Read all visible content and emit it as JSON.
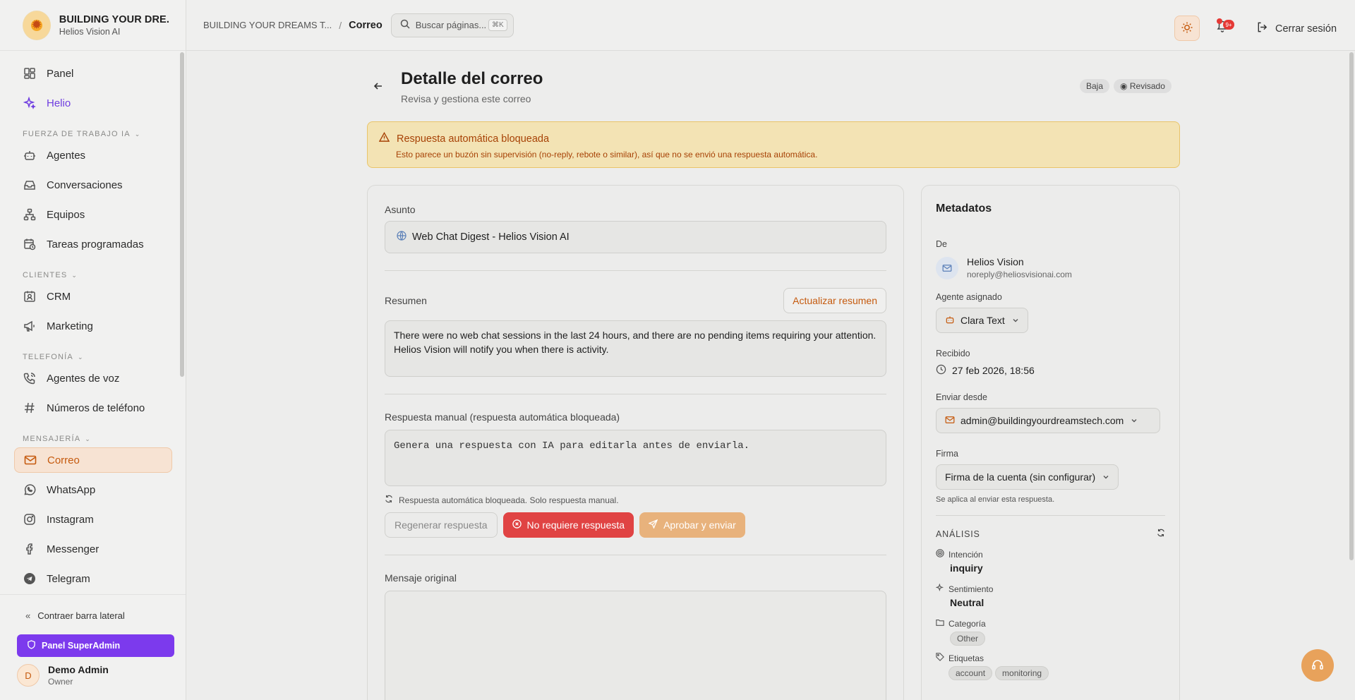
{
  "brand": {
    "name": "BUILDING YOUR DRE...",
    "sub": "Helios Vision AI"
  },
  "nav": {
    "panel": "Panel",
    "helio": "Helio",
    "section_ai": "FUERZA DE TRABAJO IA",
    "agents": "Agentes",
    "conversations": "Conversaciones",
    "teams": "Equipos",
    "scheduled": "Tareas programadas",
    "section_clients": "CLIENTES",
    "crm": "CRM",
    "marketing": "Marketing",
    "section_phone": "TELEFONÍA",
    "voice_agents": "Agentes de voz",
    "phone_numbers": "Números de teléfono",
    "section_messaging": "MENSAJERÍA",
    "email": "Correo",
    "whatsapp": "WhatsApp",
    "instagram": "Instagram",
    "messenger": "Messenger",
    "telegram": "Telegram"
  },
  "footer": {
    "collapse": "Contraer barra lateral",
    "superadmin": "Panel SuperAdmin",
    "user_initial": "D",
    "user_name": "Demo Admin",
    "user_role": "Owner"
  },
  "topbar": {
    "crumb_org": "BUILDING YOUR DREAMS T...",
    "crumb_sep": "/",
    "crumb_page": "Correo",
    "search_placeholder": "Buscar páginas...",
    "search_kbd": "⌘K",
    "bell_badge": "9+",
    "logout": "Cerrar sesión"
  },
  "page": {
    "title": "Detalle del correo",
    "subtitle": "Revisa y gestiona este correo",
    "badge_priority": "Baja",
    "badge_status": "Revisado"
  },
  "alert": {
    "title": "Respuesta automática bloqueada",
    "body": "Esto parece un buzón sin supervisión (no-reply, rebote o similar), así que no se envió una respuesta automática."
  },
  "email": {
    "subject_label": "Asunto",
    "subject": "Web Chat Digest - Helios Vision AI",
    "summary_label": "Resumen",
    "update_summary": "Actualizar resumen",
    "summary": "There were no web chat sessions in the last 24 hours, and there are no pending items requiring your attention. Helios Vision will notify you when there is activity.",
    "manual_label": "Respuesta manual (respuesta automática bloqueada)",
    "manual_placeholder": "Genera una respuesta con IA para editarla antes de enviarla.",
    "hint": "Respuesta automática bloqueada. Solo respuesta manual.",
    "btn_regen": "Regenerar respuesta",
    "btn_no_reply": "No requiere respuesta",
    "btn_approve": "Aprobar y enviar",
    "original_label": "Mensaje original"
  },
  "meta": {
    "title": "Metadatos",
    "from_label": "De",
    "from_name": "Helios Vision",
    "from_email": "noreply@heliosvisionai.com",
    "agent_label": "Agente asignado",
    "agent": "Clara Text",
    "received_label": "Recibido",
    "received": "27 feb 2026, 18:56",
    "send_from_label": "Enviar desde",
    "send_from": "admin@buildingyourdreamstech.com",
    "signature_label": "Firma",
    "signature": "Firma de la cuenta (sin configurar)",
    "signature_note": "Se aplica al enviar esta respuesta.",
    "analysis_label": "ANÁLISIS",
    "intent_label": "Intención",
    "intent": "inquiry",
    "sentiment_label": "Sentimiento",
    "sentiment": "Neutral",
    "category_label": "Categoría",
    "category": "Other",
    "tags_label": "Etiquetas",
    "tags": [
      "account",
      "monitoring"
    ]
  },
  "colors": {
    "accent": "#c55a0e",
    "purple": "#7c3aed",
    "danger": "#e04343"
  }
}
